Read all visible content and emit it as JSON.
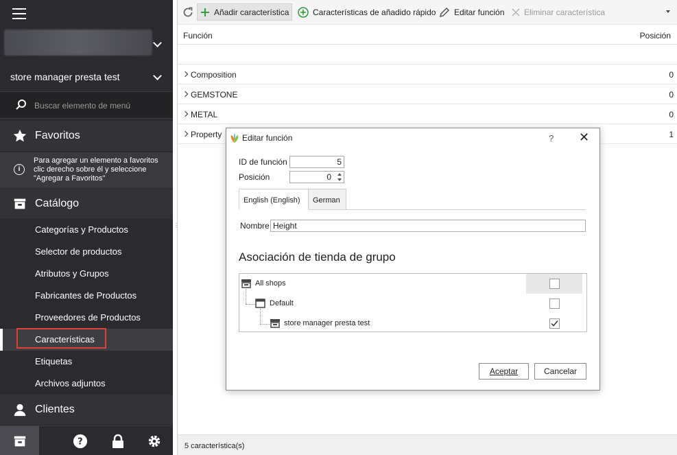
{
  "sidebar": {
    "store_name": "store manager presta test",
    "search_placeholder": "Buscar elemento de menú",
    "favorites": {
      "label": "Favoritos",
      "hint": "Para agregar un elemento a favoritos clic derecho sobre él y seleccione \"Agregar a Favoritos\""
    },
    "catalog": {
      "label": "Catálogo",
      "items": [
        {
          "label": "Categorías y Productos"
        },
        {
          "label": "Selector de productos"
        },
        {
          "label": "Atributos y Grupos"
        },
        {
          "label": "Fabricantes de Productos"
        },
        {
          "label": "Proveedores de Productos"
        },
        {
          "label": "Características",
          "active": true
        },
        {
          "label": "Etiquetas"
        },
        {
          "label": "Archivos adjuntos"
        }
      ]
    },
    "clients": {
      "label": "Clientes"
    },
    "bottom_icons": [
      "store-icon",
      "help-icon",
      "lock-icon",
      "gear-icon"
    ]
  },
  "toolbar": {
    "add_feature": "Añadir característica",
    "quick_add": "Características de añadido rápido",
    "edit_feature": "Editar función",
    "delete_feature": "Eliminar característica"
  },
  "grid": {
    "columns": {
      "function": "Función",
      "position": "Posición"
    },
    "rows": [
      {
        "name": "Composition",
        "position": "0"
      },
      {
        "name": "GEMSTONE",
        "position": "0"
      },
      {
        "name": "METAL",
        "position": "0"
      },
      {
        "name": "Property",
        "position": "1"
      }
    ]
  },
  "status": {
    "count": "5 característica(s)"
  },
  "dialog": {
    "title": "Editar función",
    "help": "?",
    "close": "✕",
    "id_label": "ID de función",
    "id_value": "5",
    "position_label": "Posición",
    "position_value": "0",
    "tabs": [
      {
        "label": "English (English)",
        "active": true
      },
      {
        "label": "German",
        "active": false
      }
    ],
    "name_label": "Nombre",
    "name_value": "Height",
    "shop_section_title": "Asociación de tienda de grupo",
    "shops": [
      {
        "label": "All shops",
        "checked": false
      },
      {
        "label": "Default",
        "checked": false
      },
      {
        "label": "store manager presta test",
        "checked": true
      }
    ],
    "accept": "Aceptar",
    "cancel": "Cancelar"
  },
  "colors": {
    "sidebar_bg": "#2b2b2f",
    "highlight_border": "#e0403a",
    "add_icon": "#2e9e3a"
  }
}
